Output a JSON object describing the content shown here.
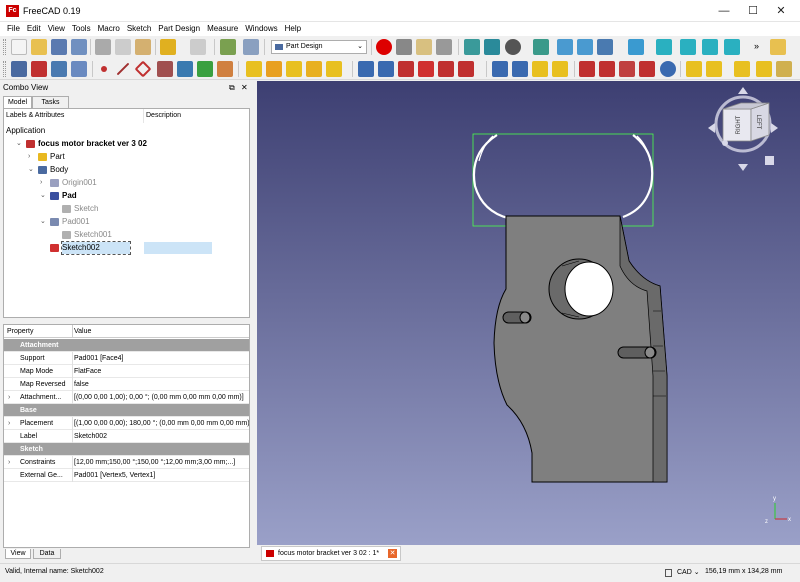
{
  "window": {
    "title": "FreeCAD 0.19",
    "app_icon": "freecad-logo-icon",
    "controls": [
      "—",
      "☐",
      "✕"
    ]
  },
  "menu": [
    "File",
    "Edit",
    "View",
    "Tools",
    "Macro",
    "Sketch",
    "Part Design",
    "Measure",
    "Windows",
    "Help"
  ],
  "workbench": {
    "selected": "Part Design"
  },
  "toolbar_overflow": "»",
  "combo": {
    "title": "Combo View",
    "buttons": [
      "⧉",
      "✕"
    ],
    "tabs": [
      "Model",
      "Tasks"
    ]
  },
  "tree": {
    "columns": [
      "Labels & Attributes",
      "Description"
    ],
    "root_label": "Application",
    "items": [
      {
        "label": "focus motor bracket ver 3 02",
        "icon": "document-icon",
        "color": "#c03030",
        "bold": true,
        "arrow": "⌄"
      },
      {
        "label": "Part",
        "icon": "part-icon",
        "color": "#e8b820",
        "bold": false,
        "arrow": "›"
      },
      {
        "label": "Body",
        "icon": "body-icon",
        "color": "#4a6aa0",
        "bold": false,
        "arrow": "⌄"
      },
      {
        "label": "Origin001",
        "icon": "origin-icon",
        "color": "#9aa0c0",
        "bold": false,
        "arrow": "›",
        "gray": true
      },
      {
        "label": "Pad",
        "icon": "pad-icon",
        "color": "#3a4fa0",
        "bold": true,
        "arrow": "⌄"
      },
      {
        "label": "Sketch",
        "icon": "sketch-icon",
        "color": "#b0b0b0",
        "bold": false,
        "arrow": "",
        "gray": true
      },
      {
        "label": "Pad001",
        "icon": "pad-icon",
        "color": "#7a8ab0",
        "bold": false,
        "arrow": "⌄",
        "gray": true
      },
      {
        "label": "Sketch001",
        "icon": "sketch-icon",
        "color": "#b0b0b0",
        "bold": false,
        "arrow": "",
        "gray": true
      },
      {
        "label": "Sketch002",
        "icon": "sketch-icon",
        "color": "#d03030",
        "bold": false,
        "arrow": "",
        "selected": true
      }
    ]
  },
  "properties": {
    "columns": [
      "Property",
      "Value"
    ],
    "rows": [
      {
        "group": "Attachment"
      },
      {
        "name": "Support",
        "value": "Pad001 [Face4]"
      },
      {
        "name": "Map Mode",
        "value": "FlatFace"
      },
      {
        "name": "Map Reversed",
        "value": "false"
      },
      {
        "name": "Attachment...",
        "value": "[(0,00 0,00 1,00); 0,00 °; (0,00 mm  0,00 mm  0,00 mm)]",
        "expand": "›"
      },
      {
        "group": "Base"
      },
      {
        "name": "Placement",
        "value": "[(1,00 0,00 0,00); 180,00 °; (0,00 mm  0,00 mm  0,00 mm)]",
        "expand": "›"
      },
      {
        "name": "Label",
        "value": "Sketch002"
      },
      {
        "group": "Sketch"
      },
      {
        "name": "Constraints",
        "value": "[12,00 mm;150,00 °;150,00 °;12,00 mm;3,00 mm;...]",
        "expand": "›"
      },
      {
        "name": "External Ge...",
        "value": "Pad001 [Vertex5, Vertex1]"
      }
    ]
  },
  "bottom_tabs": [
    "View",
    "Data"
  ],
  "doc_tab": {
    "label": "focus motor bracket ver 3 02 : 1*",
    "close": "✕"
  },
  "navcube": {
    "left_face": "RIGHT",
    "right_face": "LEFT"
  },
  "status": {
    "message": "Valid, Internal name: Sketch002",
    "nav_style": "CAD ⌄",
    "dimensions": "156,19 mm x 134,28 mm"
  }
}
